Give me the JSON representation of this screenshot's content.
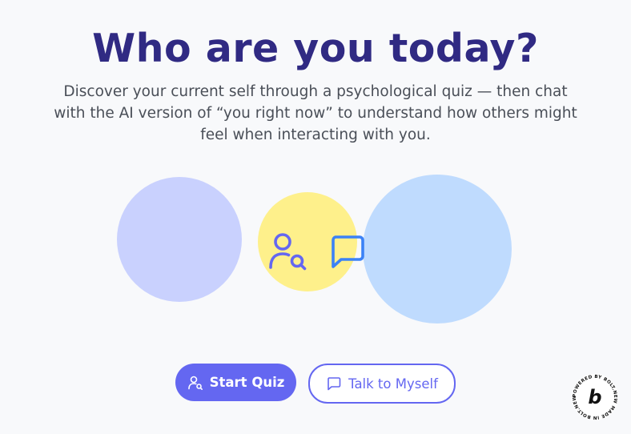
{
  "hero": {
    "title": "Who are you today?",
    "subtitle": "Discover your current self through a psychological quiz — then chat with the AI version of “you right now” to understand how others might feel when interacting with you."
  },
  "illustration": {
    "icons": [
      "user-search-icon",
      "chat-bubble-icon"
    ],
    "colors": {
      "circle_left": "#c9d1fe",
      "circle_mid": "#fef08b",
      "circle_right": "#bfdbfe",
      "icon_user": "#6467f1",
      "icon_chat": "#3b82f6"
    }
  },
  "actions": {
    "start_quiz_label": "Start Quiz",
    "talk_label": "Talk to Myself"
  },
  "badge": {
    "text": "POWERED BY BOLT.NEW MADE IN BOLT.NEW",
    "letter": "b"
  },
  "theme": {
    "title_color": "#302a83",
    "accent": "#6467f1",
    "background": "#f8f9fb"
  }
}
